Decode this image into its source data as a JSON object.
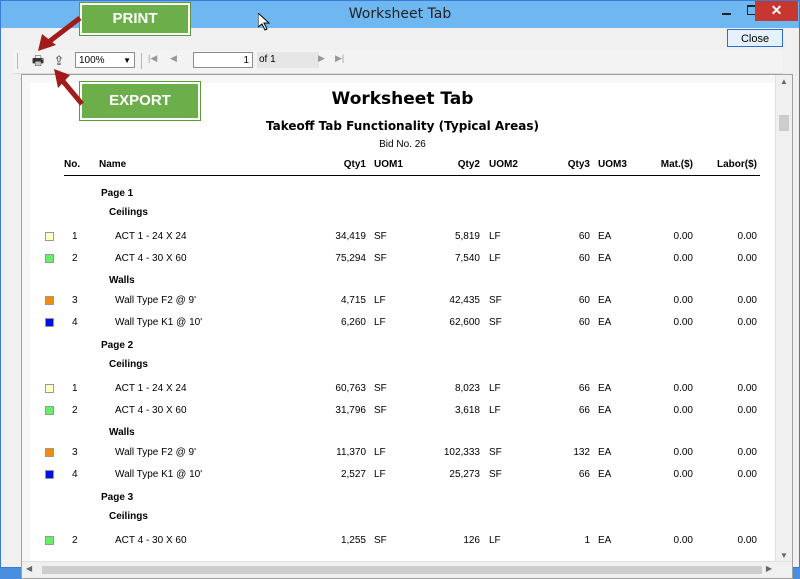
{
  "window": {
    "title": "Worksheet Tab",
    "close_button": "Close"
  },
  "toolbar": {
    "print_icon": "print-icon",
    "export_icon": "export-icon",
    "zoom_value": "100%",
    "page_value": "1",
    "page_of": "of 1"
  },
  "callouts": {
    "print": "PRINT",
    "export": "EXPORT"
  },
  "report": {
    "title": "Worksheet Tab",
    "subtitle": "Takeoff Tab Functionality (Typical Areas)",
    "bid": "Bid No. 26",
    "columns": {
      "no": "No.",
      "name": "Name",
      "qty1": "Qty1",
      "uom1": "UOM1",
      "qty2": "Qty2",
      "uom2": "UOM2",
      "qty3": "Qty3",
      "uom3": "UOM3",
      "mat": "Mat.($)",
      "labor": "Labor($)"
    },
    "rows": [
      {
        "kind": "page",
        "label": "Page 1"
      },
      {
        "kind": "group",
        "label": "Ceilings"
      },
      {
        "kind": "item",
        "color": "#ffffcc",
        "no": "1",
        "name": "ACT 1 - 24 X 24",
        "qty1": "34,419",
        "uom1": "SF",
        "qty2": "5,819",
        "uom2": "LF",
        "qty3": "60",
        "uom3": "EA",
        "mat": "0.00",
        "labor": "0.00"
      },
      {
        "kind": "item",
        "color": "#66ee66",
        "no": "2",
        "name": "ACT 4 - 30 X 60",
        "qty1": "75,294",
        "uom1": "SF",
        "qty2": "7,540",
        "uom2": "LF",
        "qty3": "60",
        "uom3": "EA",
        "mat": "0.00",
        "labor": "0.00"
      },
      {
        "kind": "group",
        "label": "Walls"
      },
      {
        "kind": "item",
        "color": "#f08c10",
        "no": "3",
        "name": "Wall Type F2 @ 9'",
        "qty1": "4,715",
        "uom1": "LF",
        "qty2": "42,435",
        "uom2": "SF",
        "qty3": "60",
        "uom3": "EA",
        "mat": "0.00",
        "labor": "0.00"
      },
      {
        "kind": "item",
        "color": "#0010e0",
        "no": "4",
        "name": "Wall Type K1 @ 10'",
        "qty1": "6,260",
        "uom1": "LF",
        "qty2": "62,600",
        "uom2": "SF",
        "qty3": "60",
        "uom3": "EA",
        "mat": "0.00",
        "labor": "0.00"
      },
      {
        "kind": "page",
        "label": "Page 2"
      },
      {
        "kind": "group",
        "label": "Ceilings"
      },
      {
        "kind": "item",
        "color": "#ffffcc",
        "no": "1",
        "name": "ACT 1 - 24 X 24",
        "qty1": "60,763",
        "uom1": "SF",
        "qty2": "8,023",
        "uom2": "LF",
        "qty3": "66",
        "uom3": "EA",
        "mat": "0.00",
        "labor": "0.00"
      },
      {
        "kind": "item",
        "color": "#66ee66",
        "no": "2",
        "name": "ACT 4 - 30 X 60",
        "qty1": "31,796",
        "uom1": "SF",
        "qty2": "3,618",
        "uom2": "LF",
        "qty3": "66",
        "uom3": "EA",
        "mat": "0.00",
        "labor": "0.00"
      },
      {
        "kind": "group",
        "label": "Walls"
      },
      {
        "kind": "item",
        "color": "#f08c10",
        "no": "3",
        "name": "Wall Type F2 @ 9'",
        "qty1": "11,370",
        "uom1": "LF",
        "qty2": "102,333",
        "uom2": "SF",
        "qty3": "132",
        "uom3": "EA",
        "mat": "0.00",
        "labor": "0.00"
      },
      {
        "kind": "item",
        "color": "#0010e0",
        "no": "4",
        "name": "Wall Type K1 @ 10'",
        "qty1": "2,527",
        "uom1": "LF",
        "qty2": "25,273",
        "uom2": "SF",
        "qty3": "66",
        "uom3": "EA",
        "mat": "0.00",
        "labor": "0.00"
      },
      {
        "kind": "page",
        "label": "Page 3"
      },
      {
        "kind": "group",
        "label": "Ceilings"
      },
      {
        "kind": "item",
        "color": "#66ee66",
        "no": "2",
        "name": "ACT 4 - 30 X 60",
        "qty1": "1,255",
        "uom1": "SF",
        "qty2": "126",
        "uom2": "LF",
        "qty3": "1",
        "uom3": "EA",
        "mat": "0.00",
        "labor": "0.00"
      }
    ]
  }
}
